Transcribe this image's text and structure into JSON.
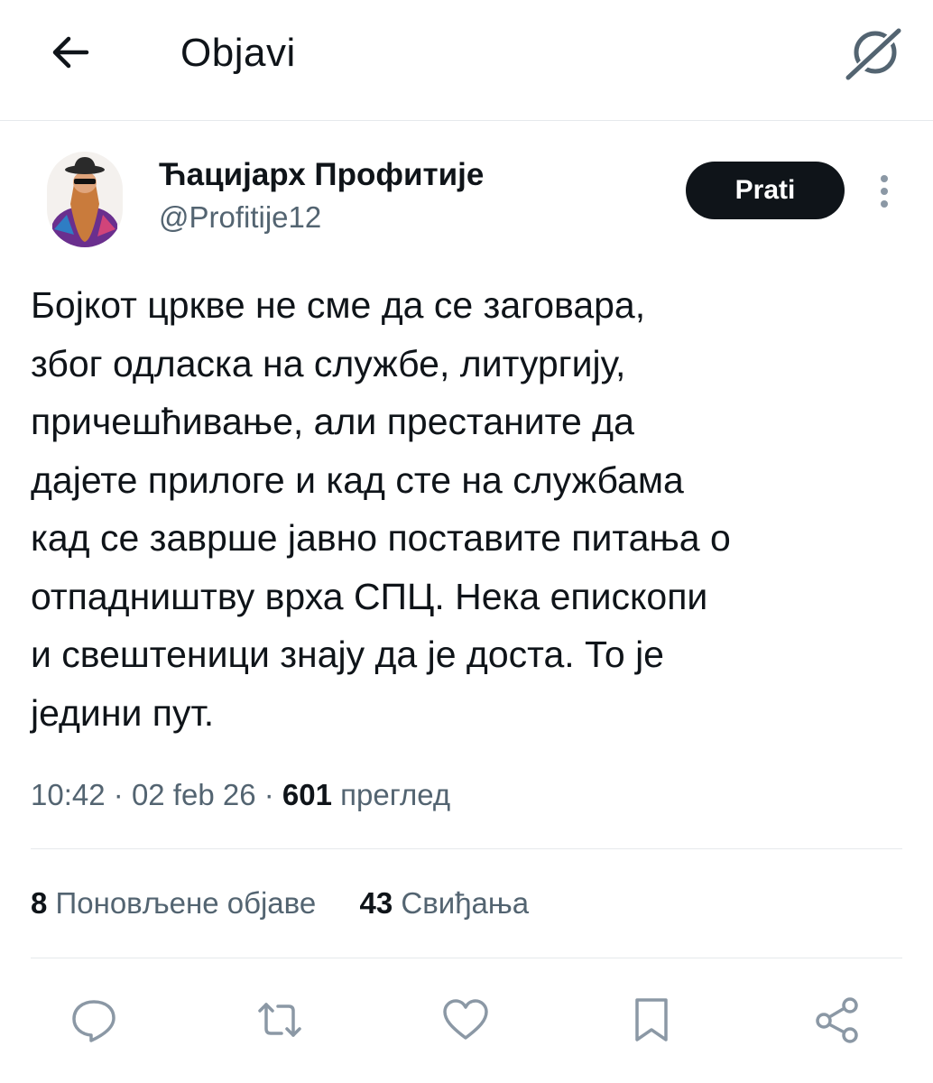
{
  "header": {
    "title": "Objavi"
  },
  "author": {
    "name": "Ћацијарх Профитије",
    "handle": "@Profitije12"
  },
  "follow_label": "Prati",
  "post": {
    "text": "Бојкот цркве не сме да се заговара,\nзбог одласка на службе, литургију,\nпричешћивање, али престаните да\nдајете прилоге и кад сте на службама\nкад се заврше јавно поставите питања о\nотпадништву врха СПЦ. Нека епископи\nи свештеници знају да је доста. То је\nједини пут."
  },
  "meta": {
    "time": "10:42",
    "date": "02 feb 26",
    "views_count": "601",
    "views_label": "преглед"
  },
  "stats": {
    "reposts_count": "8",
    "reposts_label": "Поновљене објаве",
    "likes_count": "43",
    "likes_label": "Свиђања"
  },
  "icons": [
    "back-arrow-icon",
    "grok-icon",
    "more-vertical-icon",
    "reply-icon",
    "repost-icon",
    "like-icon",
    "bookmark-icon",
    "share-icon"
  ],
  "colors": {
    "text": "#0f1419",
    "secondary": "#536471",
    "divider": "#e6e9ec",
    "button": "#0f1419"
  }
}
